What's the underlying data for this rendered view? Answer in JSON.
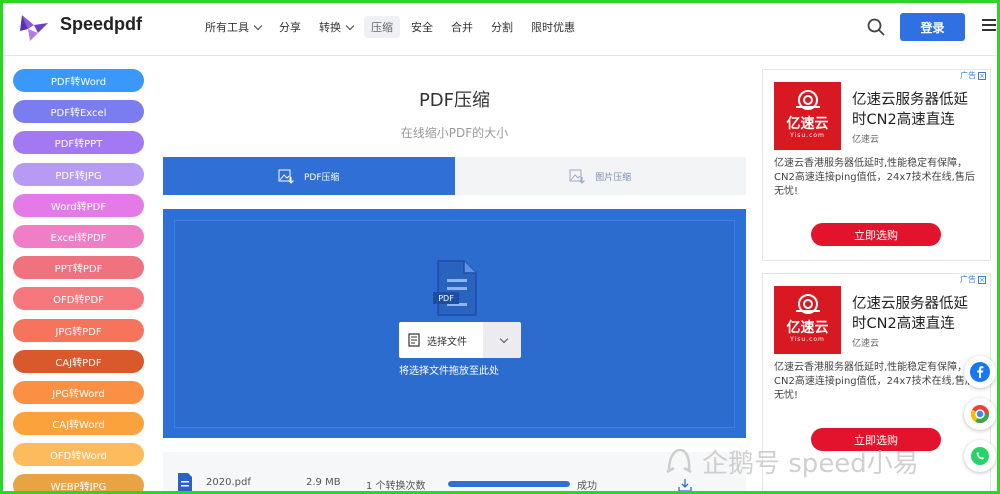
{
  "header": {
    "brand": "Speedpdf",
    "nav": [
      {
        "label": "所有工具",
        "dropdown": true,
        "active": false
      },
      {
        "label": "分享",
        "dropdown": false,
        "active": false
      },
      {
        "label": "转换",
        "dropdown": true,
        "active": false
      },
      {
        "label": "压缩",
        "dropdown": false,
        "active": true
      },
      {
        "label": "安全",
        "dropdown": false,
        "active": false
      },
      {
        "label": "合并",
        "dropdown": false,
        "active": false
      },
      {
        "label": "分割",
        "dropdown": false,
        "active": false
      },
      {
        "label": "限时优惠",
        "dropdown": false,
        "active": false
      }
    ],
    "login_label": "登录",
    "search_icon": "search-icon",
    "menu_icon": "hamburger-menu-icon"
  },
  "sidebar": {
    "items": [
      {
        "label": "PDF转Word",
        "color": "#3b98fb"
      },
      {
        "label": "PDF转Excel",
        "color": "#7c7cf1"
      },
      {
        "label": "PDF转PPT",
        "color": "#a378f3"
      },
      {
        "label": "PDF转JPG",
        "color": "#b69af4"
      },
      {
        "label": "Word转PDF",
        "color": "#e37ae8"
      },
      {
        "label": "Excel转PDF",
        "color": "#f07ec6"
      },
      {
        "label": "PPT转PDF",
        "color": "#f0727e"
      },
      {
        "label": "OFD转PDF",
        "color": "#f6787c"
      },
      {
        "label": "JPG转PDF",
        "color": "#f7745c"
      },
      {
        "label": "CAJ转PDF",
        "color": "#d9582c"
      },
      {
        "label": "JPG转Word",
        "color": "#fb8f43"
      },
      {
        "label": "CAJ转Word",
        "color": "#fca23d"
      },
      {
        "label": "OFD转Word",
        "color": "#fdbb5d"
      },
      {
        "label": "WEBP转JPG",
        "color": "#e8a344"
      }
    ]
  },
  "main": {
    "title": "PDF压缩",
    "subtitle": "在线缩小PDF的大小",
    "tabs": [
      {
        "label": "PDF压缩",
        "active": true
      },
      {
        "label": "图片压缩",
        "active": false
      }
    ],
    "upload": {
      "icon_label": "PDF",
      "select_label": "选择文件",
      "drag_hint": "将选择文件拖放至此处"
    },
    "file": {
      "name": "2020.pdf",
      "size": "2.9 MB",
      "conversions": "1 个转换次数",
      "progress": 1.0,
      "status": "成功"
    }
  },
  "ads": [
    {
      "tag": "广告",
      "logo_text": "亿速云",
      "logo_domain": "Yisu.com",
      "headline": "亿速云服务器低延时CN2高速直连",
      "brand": "亿速云",
      "description": "亿速云香港服务器低延时,性能稳定有保障，CN2高速连接ping值低，24x7技术在线,售后无忧!",
      "button": "立即选购"
    },
    {
      "tag": "广告",
      "logo_text": "亿速云",
      "logo_domain": "Yisu.com",
      "headline": "亿速云服务器低延时CN2高速直连",
      "brand": "亿速云",
      "description": "亿速云香港服务器低延时,性能稳定有保障，CN2高速连接ping值低，24x7技术在线,售后无忧!",
      "button": "立即选购"
    }
  ],
  "floating": [
    "facebook-icon",
    "chrome-icon",
    "whatsapp-icon"
  ],
  "watermark": "企鹅号 speed小易",
  "colors": {
    "primary": "#2f71e2",
    "upload_bg": "#2d6fd4",
    "ad_red": "#e3132c",
    "frame_green": "#2bd624"
  }
}
